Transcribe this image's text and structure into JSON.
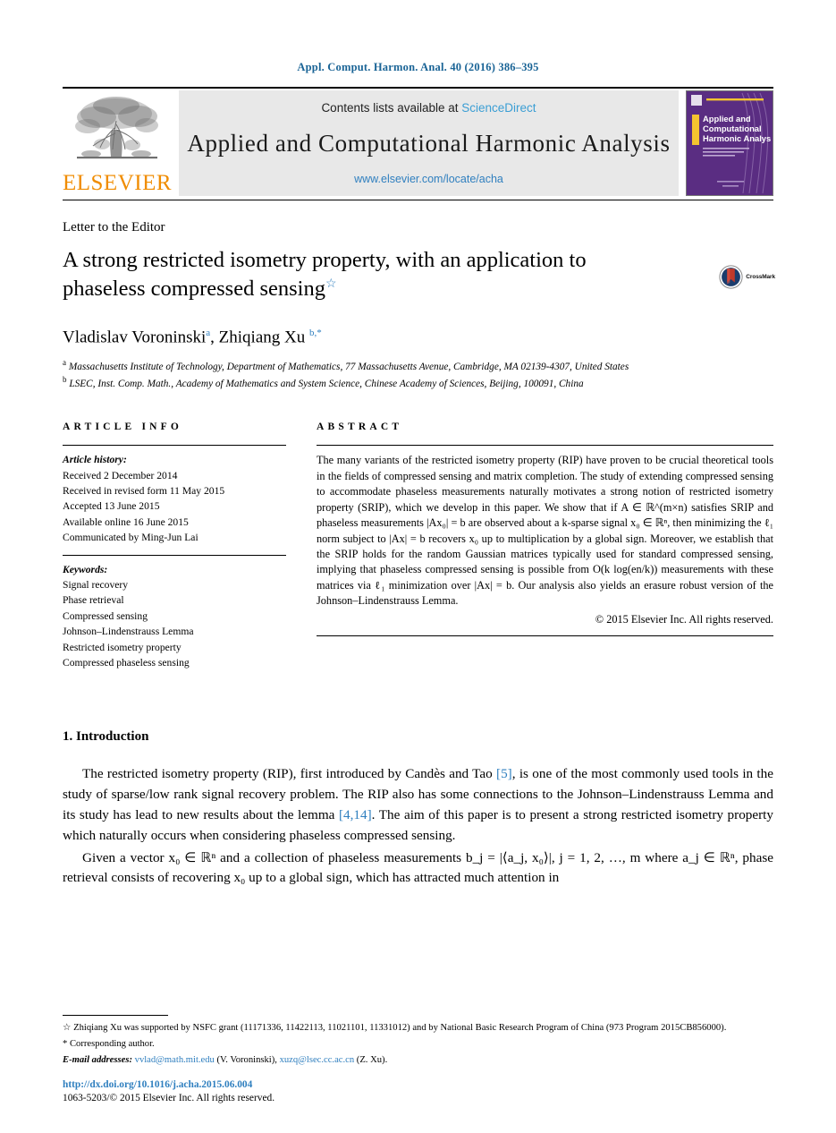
{
  "running_head": "Appl. Comput. Harmon. Anal. 40 (2016) 386–395",
  "masthead": {
    "publisher": "ELSEVIER",
    "contents_prefix": "Contents lists available at ",
    "contents_link": "ScienceDirect",
    "journal_title": "Applied and Computational Harmonic Analysis",
    "journal_url": "www.elsevier.com/locate/acha",
    "cover_line1": "Applied and",
    "cover_line2": "Computational",
    "cover_line3": "Harmonic Analysis",
    "cover_color": "#5a2d82"
  },
  "article": {
    "kicker": "Letter to the Editor",
    "title_line1": "A strong restricted isometry property, with an application to",
    "title_line2": "phaseless compressed sensing",
    "title_footnote_mark": "☆",
    "crossmark_label": "CrossMark",
    "authors_html": "Vladislav Voroninski",
    "author1": "Vladislav Voroninski",
    "author1_mark": "a",
    "author2": "Zhiqiang Xu",
    "author2_mark": "b,*",
    "affiliation_a_mark": "a",
    "affiliation_a": "Massachusetts Institute of Technology, Department of Mathematics, 77 Massachusetts Avenue, Cambridge, MA 02139-4307, United States",
    "affiliation_b_mark": "b",
    "affiliation_b": "LSEC, Inst. Comp. Math., Academy of Mathematics and System Science, Chinese Academy of Sciences, Beijing, 100091, China"
  },
  "info": {
    "heading": "ARTICLE INFO",
    "history_label": "Article history:",
    "history": [
      "Received 2 December 2014",
      "Received in revised form 11 May 2015",
      "Accepted 13 June 2015",
      "Available online 16 June 2015",
      "Communicated by Ming-Jun Lai"
    ],
    "keywords_label": "Keywords:",
    "keywords": [
      "Signal recovery",
      "Phase retrieval",
      "Compressed sensing",
      "Johnson–Lindenstrauss Lemma",
      "Restricted isometry property",
      "Compressed phaseless sensing"
    ]
  },
  "abstract": {
    "heading": "ABSTRACT",
    "text": "The many variants of the restricted isometry property (RIP) have proven to be crucial theoretical tools in the fields of compressed sensing and matrix completion. The study of extending compressed sensing to accommodate phaseless measurements naturally motivates a strong notion of restricted isometry property (SRIP), which we develop in this paper. We show that if A ∈ ℝ^(m×n) satisfies SRIP and phaseless measurements |Ax₀| = b are observed about a k-sparse signal x₀ ∈ ℝⁿ, then minimizing the ℓ₁ norm subject to |Ax| = b recovers x₀ up to multiplication by a global sign. Moreover, we establish that the SRIP holds for the random Gaussian matrices typically used for standard compressed sensing, implying that phaseless compressed sensing is possible from O(k log(en/k)) measurements with these matrices via ℓ₁ minimization over |Ax| = b. Our analysis also yields an erasure robust version of the Johnson–Lindenstrauss Lemma.",
    "copyright": "© 2015 Elsevier Inc. All rights reserved."
  },
  "body": {
    "section_number_title": "1. Introduction",
    "para1_a": "The restricted isometry property (RIP), first introduced by Candès and Tao ",
    "para1_cite1": "[5]",
    "para1_b": ", is one of the most commonly used tools in the study of sparse/low rank signal recovery problem. The RIP also has some connections to the Johnson–Lindenstrauss Lemma and its study has lead to new results about the lemma ",
    "para1_cite2": "[4,14]",
    "para1_c": ". The aim of this paper is to present a strong restricted isometry property which naturally occurs when considering phaseless compressed sensing.",
    "para2": "Given a vector x₀ ∈ ℝⁿ and a collection of phaseless measurements b_j = |⟨a_j, x₀⟩|, j = 1, 2, …, m where a_j ∈ ℝⁿ, phase retrieval consists of recovering x₀ up to a global sign, which has attracted much attention in"
  },
  "footer": {
    "star_mark": "☆",
    "funding_note": "Zhiqiang Xu was supported by NSFC grant (11171336, 11422113, 11021101, 11331012) and by National Basic Research Program of China (973 Program 2015CB856000).",
    "corresponding_mark": "*",
    "corresponding_note": "Corresponding author.",
    "email_label": "E-mail addresses:",
    "email1": "vvlad@math.mit.edu",
    "email1_owner": "(V. Voroninski)",
    "email2": "xuzq@lsec.cc.ac.cn",
    "email2_owner": "(Z. Xu).",
    "doi": "http://dx.doi.org/10.1016/j.acha.2015.06.004",
    "issn_line": "1063-5203/© 2015 Elsevier Inc. All rights reserved."
  }
}
